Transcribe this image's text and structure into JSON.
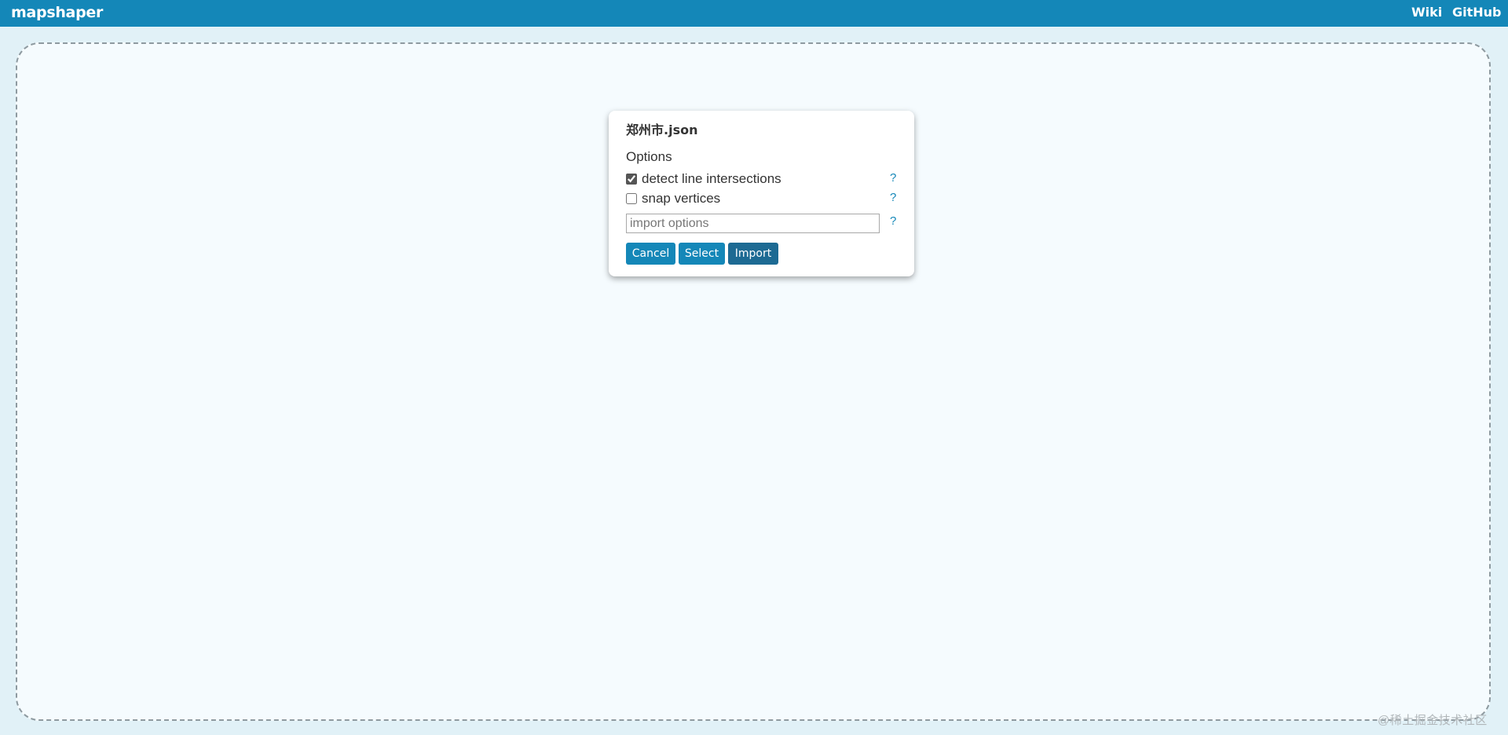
{
  "topbar": {
    "logo": "mapshaper",
    "links": {
      "wiki": "Wiki",
      "github": "GitHub"
    },
    "color": "#1487b8"
  },
  "dialog": {
    "filename": "郑州市.json",
    "options_heading": "Options",
    "options": [
      {
        "label": "detect line intersections",
        "checked": true
      },
      {
        "label": "snap vertices",
        "checked": false
      }
    ],
    "import_input": {
      "value": "",
      "placeholder": "import options"
    },
    "help_glyph": "?",
    "buttons": {
      "cancel": "Cancel",
      "select": "Select",
      "import": "Import"
    }
  },
  "watermark": "@稀土掘金技术社区",
  "colors": {
    "accent": "#1487b8",
    "import_button": "#1d6a93",
    "dropzone_bg": "#f5fbfe",
    "page_bg": "#e1f1f7"
  },
  "icons": [
    "help-icon",
    "checkbox-icon"
  ]
}
